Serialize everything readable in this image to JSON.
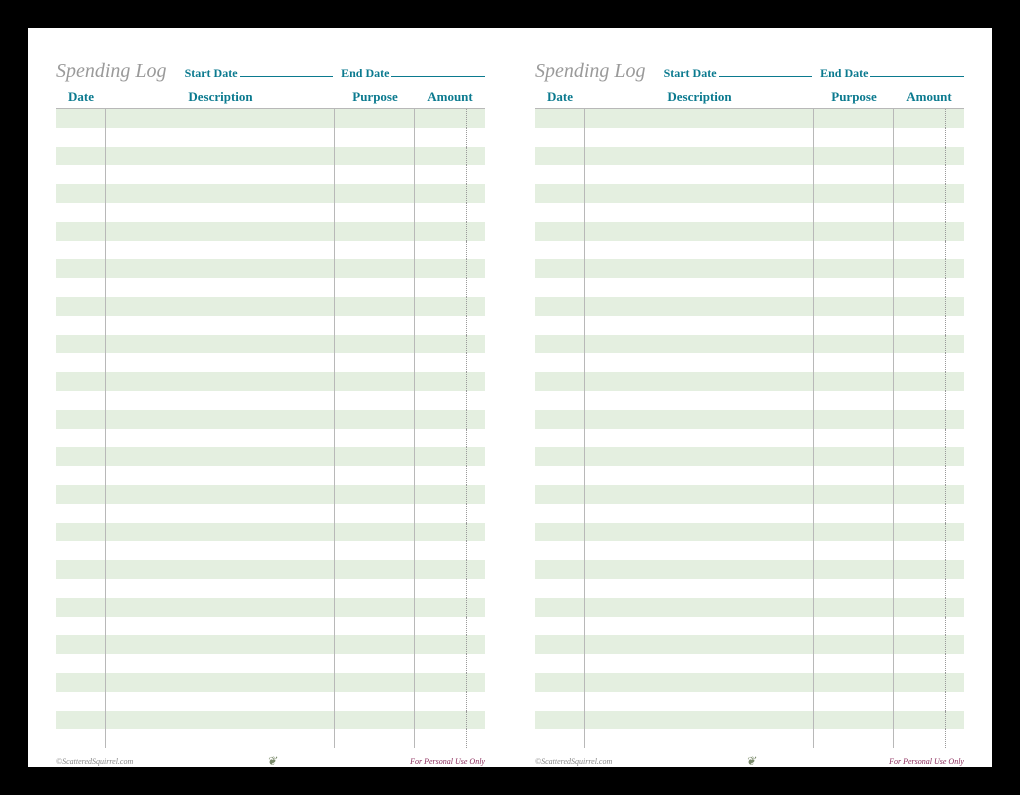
{
  "log": {
    "title": "Spending Log",
    "start_date_label": "Start Date",
    "end_date_label": "End Date",
    "columns": {
      "date": "Date",
      "description": "Description",
      "purpose": "Purpose",
      "amount": "Amount"
    },
    "row_count": 34,
    "footer": {
      "left": "©ScatteredSquirrel.com",
      "center": "❦",
      "right": "For Personal Use Only"
    }
  }
}
